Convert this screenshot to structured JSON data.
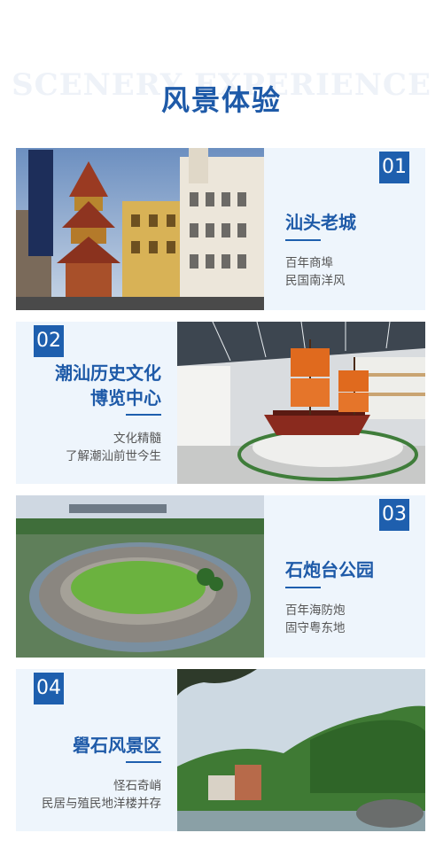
{
  "header": {
    "bg_title": "SCENERY EXPERIENCE",
    "title": "风景体验"
  },
  "spots": [
    {
      "number": "01",
      "title_lines": [
        "汕头老城"
      ],
      "desc_lines": [
        "百年商埠",
        "民国南洋风"
      ]
    },
    {
      "number": "02",
      "title_lines": [
        "潮汕历史文化",
        "博览中心"
      ],
      "desc_lines": [
        "文化精髓",
        "了解潮汕前世今生"
      ]
    },
    {
      "number": "03",
      "title_lines": [
        "石炮台公园"
      ],
      "desc_lines": [
        "百年海防炮",
        "固守粤东地"
      ]
    },
    {
      "number": "04",
      "title_lines": [
        "礐石风景区"
      ],
      "desc_lines": [
        "怪石奇峭",
        "民居与殖民地洋楼并存"
      ]
    }
  ],
  "colors": {
    "accent": "#1e5fae",
    "title": "#1e5aa8",
    "card_bg": "#eef5fc"
  }
}
